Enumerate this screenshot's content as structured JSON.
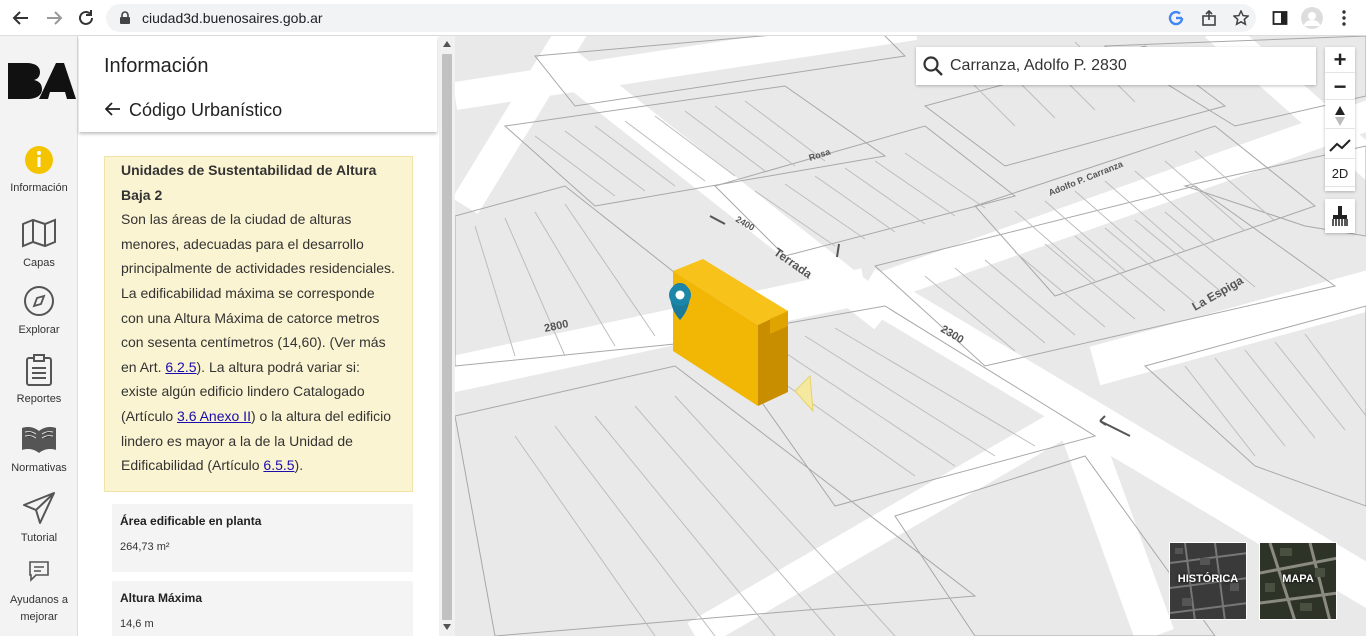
{
  "browser": {
    "url": "ciudad3d.buenosaires.gob.ar"
  },
  "rail": {
    "logo_text": "BA",
    "items": [
      {
        "label": "Información",
        "icon": "info-icon"
      },
      {
        "label": "Capas",
        "icon": "map-layers-icon"
      },
      {
        "label": "Explorar",
        "icon": "compass-icon"
      },
      {
        "label": "Reportes",
        "icon": "clipboard-icon"
      },
      {
        "label": "Normativas",
        "icon": "book-icon"
      },
      {
        "label": "Tutorial",
        "icon": "paper-plane-icon"
      },
      {
        "label": "Ayudanos a mejorar",
        "icon": "chat-icon"
      }
    ]
  },
  "panel": {
    "title": "Información",
    "subtitle": "Código Urbanístico",
    "description": {
      "heading1": "Unidades de Sustentabilidad de Altura",
      "heading2": "Baja 2",
      "text_a": "Son las áreas de la ciudad de alturas menores, adecuadas para el desarrollo principalmente de actividades residenciales. La edificabilidad máxima se corresponde con una Altura Máxima de catorce metros con sesenta centímetros (14,60). (Ver más en Art. ",
      "link1": "6.2.5",
      "text_b": "). La altura podrá variar si: existe algún edificio lindero Catalogado (Artículo ",
      "link2": "3.6 Anexo II",
      "text_c": ") o la altura del edificio lindero es mayor a la de la Unidad de Edificabilidad (Artículo ",
      "link3": "6.5.5",
      "text_d": ")."
    },
    "cards": [
      {
        "label": "Área edificable en planta",
        "value": "264,73 m²"
      },
      {
        "label": "Altura Máxima",
        "value": "14,6 m"
      }
    ]
  },
  "map": {
    "search_value": "Carranza, Adolfo P. 2830",
    "controls": {
      "zoom_in": "+",
      "zoom_out": "−",
      "mode_2d": "2D"
    },
    "street_labels": [
      "2800",
      "Terrada",
      "2300",
      "La Espiga",
      "Adolfo P. Carranza",
      "Rosa",
      "2400"
    ],
    "basemap_tiles": [
      "HISTÓRICA",
      "MAPA"
    ],
    "building_color": "#f2b705"
  }
}
